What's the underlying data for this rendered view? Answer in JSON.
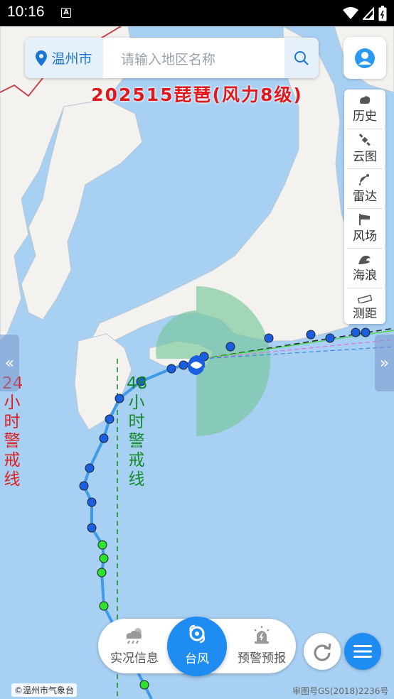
{
  "status_bar": {
    "time": "10:16",
    "notification_icon": "A"
  },
  "search": {
    "city": "温州市",
    "placeholder": "请输入地区名称"
  },
  "typhoon_title": "202515琵琶(风力8级)",
  "tools": [
    {
      "label": "历史",
      "icon": "history-icon"
    },
    {
      "label": "云图",
      "icon": "satellite-icon"
    },
    {
      "label": "雷达",
      "icon": "radar-icon"
    },
    {
      "label": "风场",
      "icon": "wind-icon"
    },
    {
      "label": "海浪",
      "icon": "wave-icon"
    },
    {
      "label": "测距",
      "icon": "ruler-icon"
    }
  ],
  "warning_lines": {
    "line24": "24小时警戒线",
    "line48": "48小时警戒线"
  },
  "bottom_nav": {
    "live": "实况信息",
    "typhoon": "台风",
    "warning": "预警预报"
  },
  "credit": "©温州市气象台",
  "approval": "审图号GS(2018)2236号",
  "colors": {
    "accent": "#1e8cf0",
    "title_red": "#e0191d",
    "warn24_red": "#e01e1e",
    "warn48_green": "#138a2a",
    "sea": "#a8d0f3",
    "land": "#f4f2ee"
  }
}
